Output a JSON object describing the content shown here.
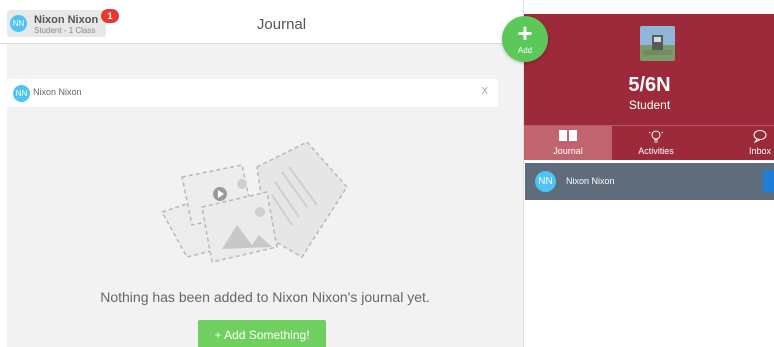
{
  "header": {
    "user_avatar": "NN",
    "user_name": "Nixon Nixon",
    "user_subtitle": "Student - 1 Class",
    "notification_count": "1",
    "page_title": "Journal"
  },
  "filter": {
    "avatar": "NN",
    "name": "Nixon Nixon",
    "close": "X"
  },
  "empty_state": {
    "message": "Nothing has been added to Nixon Nixon's journal yet.",
    "add_button": "+ Add Something!"
  },
  "fab": {
    "icon": "plus-icon",
    "label": "Add"
  },
  "class_panel": {
    "title": "5/6N",
    "subtitle": "Student",
    "tabs": [
      {
        "label": "Journal",
        "icon": "book-icon",
        "active": true
      },
      {
        "label": "Activities",
        "icon": "lightbulb-icon",
        "active": false
      },
      {
        "label": "Inbox",
        "icon": "chat-bubbles-icon",
        "active": false
      }
    ],
    "students": [
      {
        "avatar": "NN",
        "name": "Nixon Nixon"
      }
    ]
  },
  "colors": {
    "brand": "#9c2a3a",
    "active_tab": "#c0656f",
    "add_green": "#5cc85a",
    "avatar_blue": "#4fc3f7",
    "badge_red": "#e53935",
    "student_row": "#5f6c7b"
  }
}
